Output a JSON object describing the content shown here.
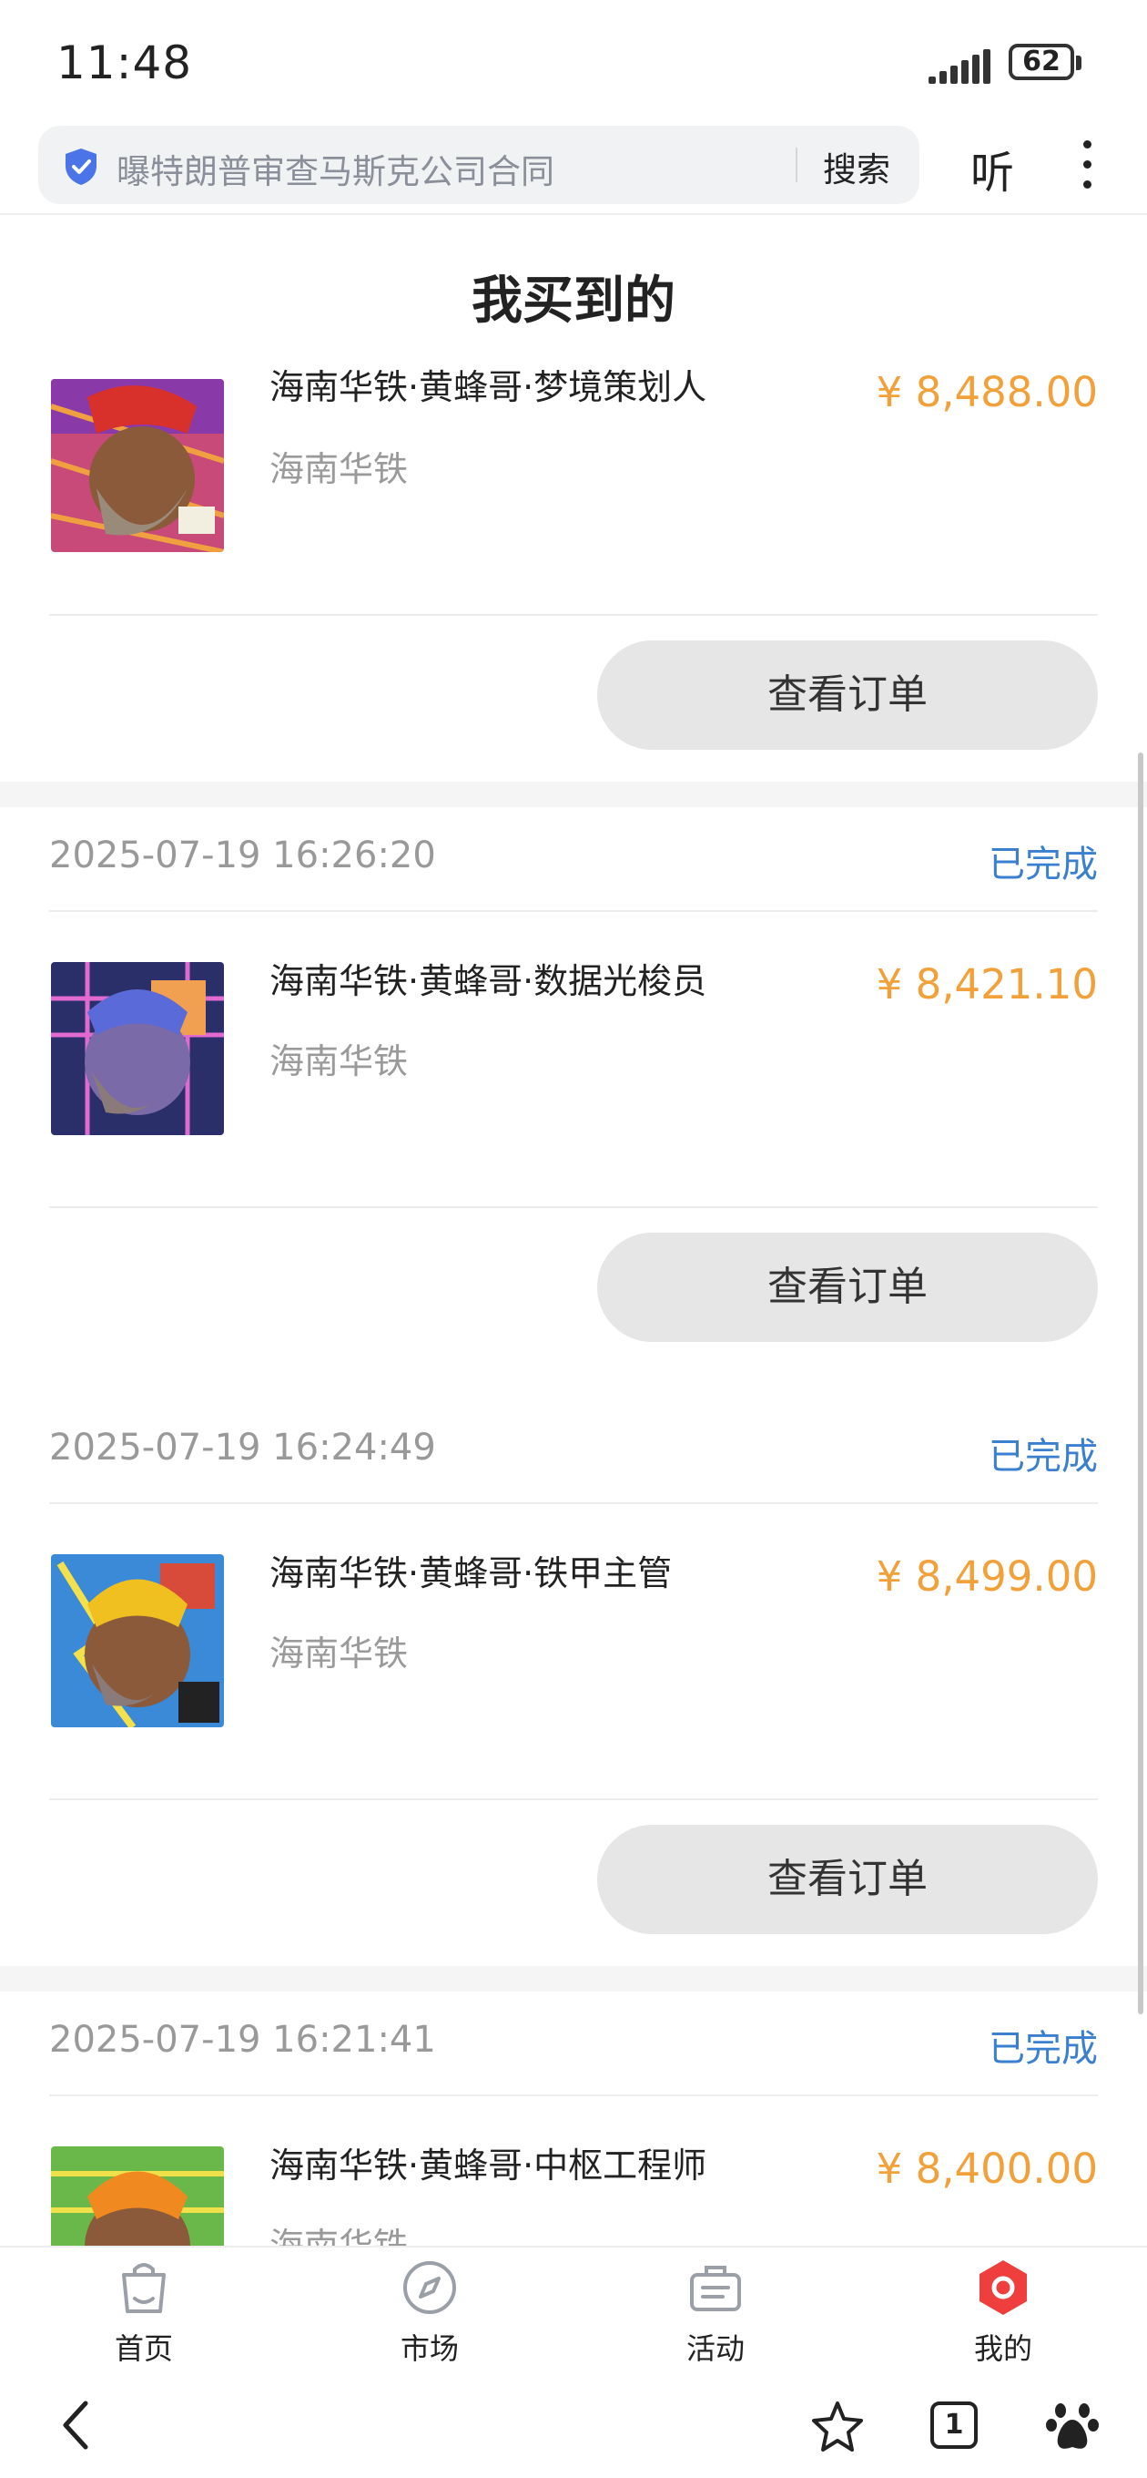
{
  "status_bar": {
    "time": "11:48",
    "battery": "62"
  },
  "browser": {
    "search_text": "曝特朗普审查马斯克公司合同",
    "search_button": "搜索",
    "listen_button": "听"
  },
  "page": {
    "title": "我买到的"
  },
  "orders": [
    {
      "time": "",
      "status": "",
      "product_name": "海南华铁·黄蜂哥·梦境策划人",
      "shop": "海南华铁",
      "price": "¥ 8,488.00",
      "button": "查看订单"
    },
    {
      "time": "2025-07-19 16:26:20",
      "status": "已完成",
      "product_name": "海南华铁·黄蜂哥·数据光梭员",
      "shop": "海南华铁",
      "price": "¥ 8,421.10",
      "button": "查看订单"
    },
    {
      "time": "2025-07-19 16:24:49",
      "status": "已完成",
      "product_name": "海南华铁·黄蜂哥·铁甲主管",
      "shop": "海南华铁",
      "price": "¥ 8,499.00",
      "button": "查看订单"
    },
    {
      "time": "2025-07-19 16:21:41",
      "status": "已完成",
      "product_name": "海南华铁·黄蜂哥·中枢工程师",
      "shop": "海南华铁",
      "price": "¥ 8,400.00",
      "button": ""
    }
  ],
  "tabbar": [
    {
      "label": "首页",
      "icon": "shopping-bag-icon"
    },
    {
      "label": "市场",
      "icon": "compass-icon"
    },
    {
      "label": "活动",
      "icon": "briefcase-icon"
    },
    {
      "label": "我的",
      "icon": "profile-icon",
      "active": true
    }
  ],
  "system_nav": {
    "tab_count": "1"
  },
  "colors": {
    "price": "#f2a13a",
    "status": "#3a7fd0",
    "active_tab": "#ef3e3e"
  }
}
